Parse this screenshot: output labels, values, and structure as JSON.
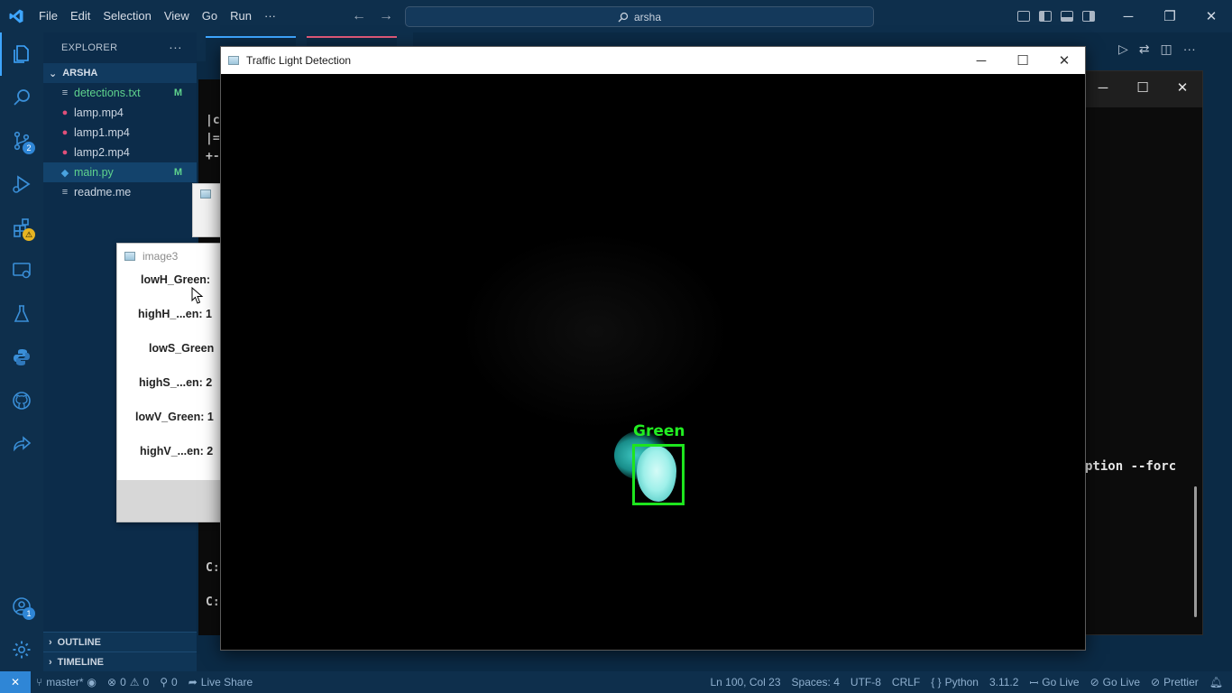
{
  "titlebar": {
    "menu": [
      "File",
      "Edit",
      "Selection",
      "View",
      "Go",
      "Run",
      "···"
    ],
    "search_text": "arsha"
  },
  "activity_badges": {
    "source_control": "2",
    "accounts": "1"
  },
  "explorer": {
    "header": "EXPLORER",
    "more": "···",
    "folder": "ARSHA",
    "files": [
      {
        "name": "detections.txt",
        "status": "M",
        "color": "#5fd38d",
        "icon": "≡",
        "icon_color": "#b8c4d2"
      },
      {
        "name": "lamp.mp4",
        "status": "",
        "color": "#cbd5e1",
        "icon": "●",
        "icon_color": "#e0507a"
      },
      {
        "name": "lamp1.mp4",
        "status": "",
        "color": "#cbd5e1",
        "icon": "●",
        "icon_color": "#e0507a"
      },
      {
        "name": "lamp2.mp4",
        "status": "",
        "color": "#cbd5e1",
        "icon": "●",
        "icon_color": "#e0507a"
      },
      {
        "name": "main.py",
        "status": "M",
        "color": "#5fd38d",
        "icon": "◆",
        "icon_color": "#4aa3df"
      },
      {
        "name": "readme.me",
        "status": "",
        "color": "#cbd5e1",
        "icon": "≡",
        "icon_color": "#b8c4d2"
      }
    ],
    "outline": "OUTLINE",
    "timeline": "TIMELINE"
  },
  "left_terminal": [
    "|c",
    "|=",
    "+-",
    "C:",
    "C:"
  ],
  "terminal_right": {
    "text": "ption --forc"
  },
  "image3_window": {
    "title": "image3",
    "trackbars": [
      "lowH_Green:",
      "highH_...en: 1",
      "lowS_Green",
      "highS_...en: 2",
      "lowV_Green: 1",
      "highV_...en: 2"
    ]
  },
  "detection_window": {
    "title": "Traffic Light Detection",
    "label": "Green",
    "label_color": "#22ee22"
  },
  "statusbar": {
    "branch": "master*",
    "errors": "0",
    "warnings": "0",
    "ports": "0",
    "live_share": "Live Share",
    "position": "Ln 100, Col 23",
    "spaces": "Spaces: 4",
    "encoding": "UTF-8",
    "eol": "CRLF",
    "language": "Python",
    "version": "3.11.2",
    "go_live_1": "Go Live",
    "go_live_2": "Go Live",
    "prettier": "Prettier"
  }
}
